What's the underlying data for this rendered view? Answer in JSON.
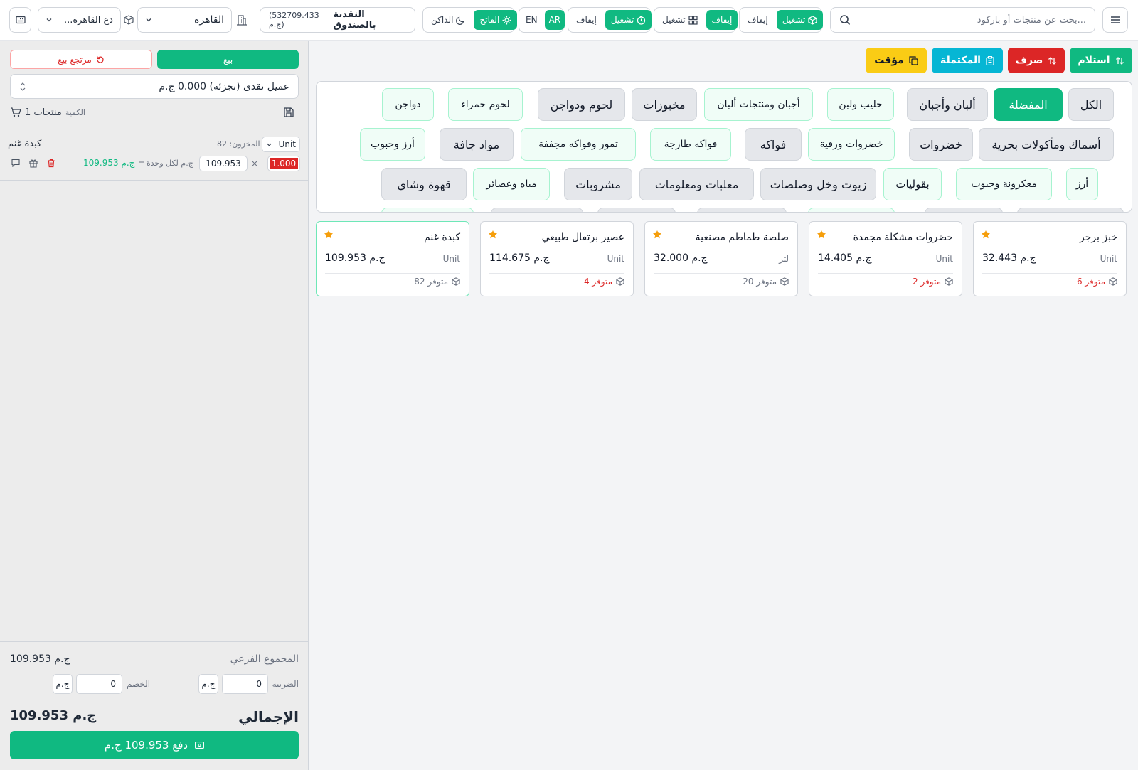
{
  "topbar": {
    "search_placeholder": "بحث عن منتجات أو باركود...",
    "toggle1": {
      "on": "تشغيل",
      "off": "إيقاف"
    },
    "toggle2": {
      "on": "تشغيل",
      "off": "إيقاف"
    },
    "toggle3": {
      "on": "تشغيل",
      "off": "إيقاف"
    },
    "lang": {
      "ar": "AR",
      "en": "EN"
    },
    "theme": {
      "light": "الفاتح",
      "dark": "الداكن"
    },
    "cash": {
      "label": "النقدية بالصندوق",
      "amount": "(532709.433 ج.م)"
    },
    "branch": "القاهرة",
    "warehouse": "...دع القاهرة"
  },
  "sidebar": {
    "sale_tab": "بيع",
    "return_tab": "مرتجع بيع",
    "customer": "عميل نقدى (تجزئة) 0.000 ج.م",
    "summary": {
      "products": "1 منتجات",
      "qty": "الكمية"
    },
    "cart": [
      {
        "name": "كبدة غنم",
        "stock": "المخزون: 82",
        "unit": "Unit",
        "qty": "1.000",
        "price": "109.953",
        "per_unit": "ج.م لكل وحدة",
        "line_total": "109.953 ج.م",
        "times": "×",
        "equals": "="
      }
    ],
    "totals": {
      "subtotal_label": "المجموع الفرعي",
      "subtotal": "109.953 ج.م",
      "tax_label": "الضريبة",
      "tax": "0",
      "tax_unit": "ج.م",
      "discount_label": "الخصم",
      "discount": "0",
      "discount_unit": "ج.م",
      "total_label": "الإجمالي",
      "total": "109.953 ج.م",
      "pay_button": "دفع 109.953 ج.م"
    }
  },
  "actions": {
    "receive": "استلام",
    "spend": "صرف",
    "completed": "المكتملة",
    "temp": "مؤقت"
  },
  "categories": {
    "row1": [
      "الكل",
      "المفضلة",
      "ألبان وأجبان",
      "حليب ولبن",
      "أجبان ومنتجات ألبان",
      "مخبوزات",
      "لحوم ودواجن",
      "لحوم حمراء",
      "دواجن"
    ],
    "row2": [
      "أسماك ومأكولات بحرية",
      "خضروات",
      "خضروات ورقية",
      "فواكه",
      "فواكه طازجة",
      "تمور وفواكه مجففة",
      "مواد جافة",
      "أرز وحبوب"
    ],
    "row3": [
      "أرز",
      "معكرونة وحبوب",
      "بقوليات",
      "زيوت وخل وصلصات",
      "معلبات ومعلومات",
      "مشروبات",
      "مياه وعصائر",
      "قهوة وشاي"
    ]
  },
  "products": [
    {
      "name": "خبز برجر",
      "unit": "Unit",
      "price": "32.443 ج.م",
      "stock": "6 متوفر",
      "low": true
    },
    {
      "name": "خضروات مشكلة مجمدة",
      "unit": "Unit",
      "price": "14.405 ج.م",
      "stock": "2 متوفر",
      "low": true
    },
    {
      "name": "صلصة طماطم مصنعية",
      "unit": "لتر",
      "price": "32.000 ج.م",
      "stock": "20 متوفر",
      "low": false
    },
    {
      "name": "عصير برتقال طبيعي",
      "unit": "Unit",
      "price": "114.675 ج.م",
      "stock": "4 متوفر",
      "low": true
    },
    {
      "name": "كبدة غنم",
      "unit": "Unit",
      "price": "109.953 ج.م",
      "stock": "82 متوفر",
      "low": false
    }
  ],
  "colors": {
    "accent": "#10b981",
    "danger": "#dc2626",
    "info": "#06b6d4",
    "warning": "#facc15",
    "star": "#f59e0b"
  }
}
